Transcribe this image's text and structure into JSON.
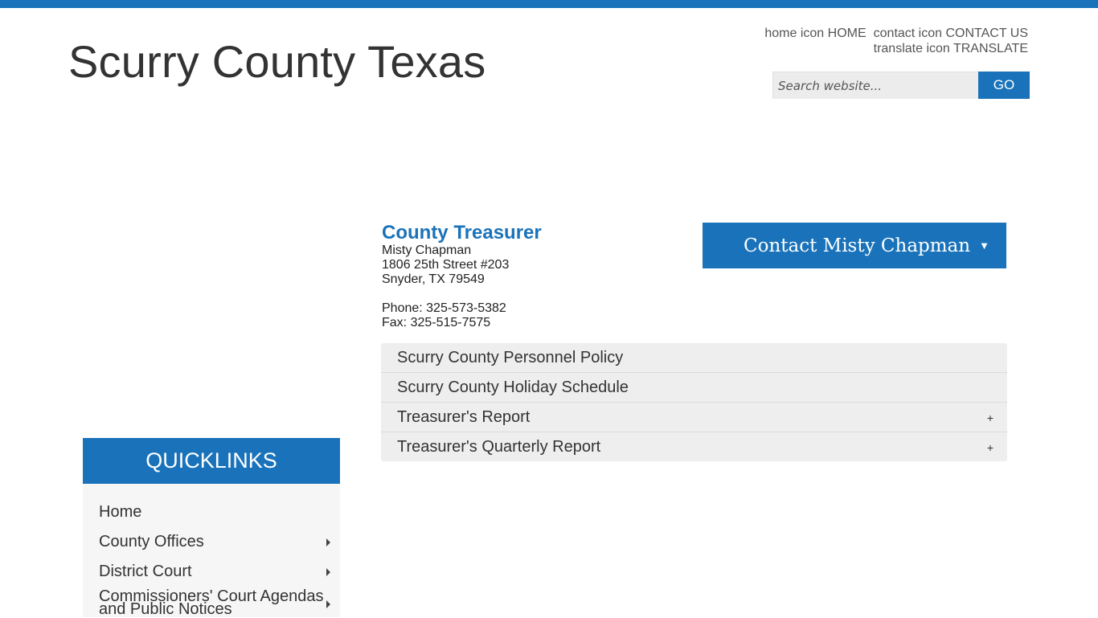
{
  "site": {
    "title": "Scurry County Texas",
    "accent_color": "#1a73ba"
  },
  "util_links": {
    "home": "home icon HOME",
    "contact": "contact icon CONTACT US",
    "translate": "translate icon TRANSLATE"
  },
  "search": {
    "placeholder": "Search website...",
    "go_label": "GO"
  },
  "department": {
    "title": "County Treasurer",
    "name": "Misty Chapman",
    "address1": "1806 25th Street #203",
    "address2": "Snyder, TX 79549",
    "phone": "Phone: 325-573-5382",
    "fax": "Fax: 325-515-7575"
  },
  "contact_button": {
    "label": "Contact Misty Chapman",
    "caret": "▼"
  },
  "documents": [
    {
      "label": "Scurry County Personnel Policy",
      "expand": ""
    },
    {
      "label": "Scurry County Holiday Schedule",
      "expand": ""
    },
    {
      "label": "Treasurer's Report",
      "expand": "+"
    },
    {
      "label": "Treasurer's Quarterly Report",
      "expand": "+"
    }
  ],
  "quicklinks": {
    "header": "QUICKLINKS",
    "items": [
      {
        "label": "Home"
      },
      {
        "label": "County Offices"
      },
      {
        "label": "District Court"
      },
      {
        "label": "Commissioners' Court Agendas and Public Notices"
      }
    ]
  }
}
